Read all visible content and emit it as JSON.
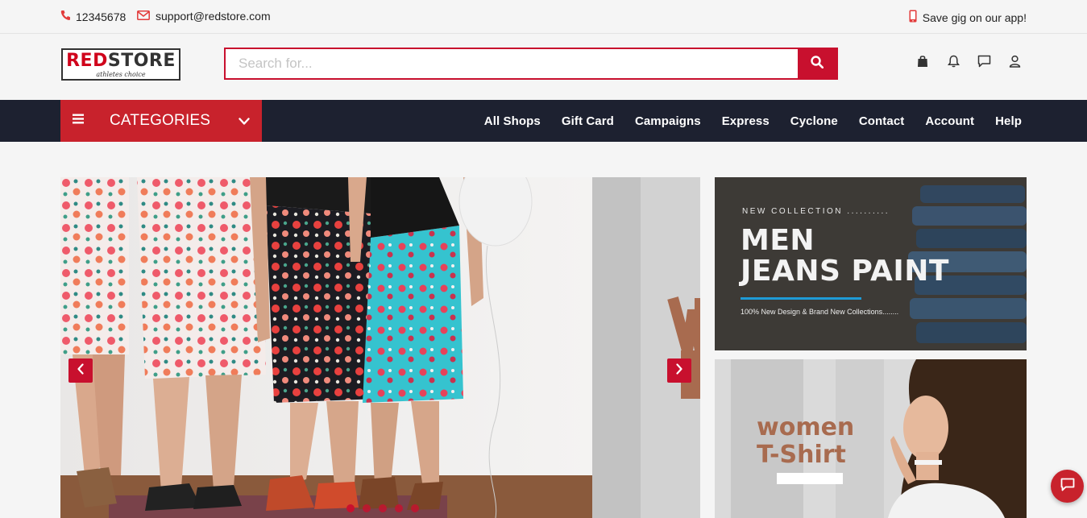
{
  "topbar": {
    "phone": "12345678",
    "email": "support@redstore.com",
    "app_text": "Save gig on our app!"
  },
  "header": {
    "logo_red": "RED",
    "logo_dark": "STORE",
    "logo_tagline": "athletes choice",
    "search_placeholder": "Search for...",
    "icons": [
      "shopping-bag-icon",
      "bell-icon",
      "chat-icon",
      "user-icon"
    ]
  },
  "nav": {
    "categories_label": "CATEGORIES",
    "links": [
      "All Shops",
      "Gift Card",
      "Campaigns",
      "Express",
      "Cyclone",
      "Contact",
      "Account",
      "Help"
    ]
  },
  "hero": {
    "slide_count": 5,
    "active_slide": 1
  },
  "banners": {
    "men": {
      "eyebrow": "NEW COLLECTION ..........",
      "title_line1": "MEN",
      "title_line2": "JEANS PAINT",
      "subtitle": "100% New Design & Brand New Collections........"
    },
    "women": {
      "title_line1": "women",
      "title_line2": "T-Shirt"
    }
  },
  "colors": {
    "brand_red": "#c8102e",
    "nav_dark": "#1d2130",
    "category_red": "#c8222c",
    "accent_blue": "#1e9bd7"
  }
}
